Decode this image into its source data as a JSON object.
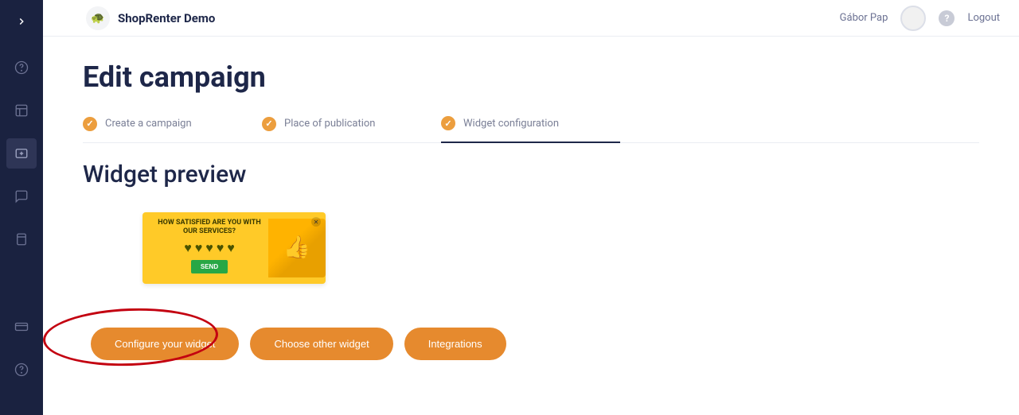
{
  "brand": {
    "name": "ShopRenter Demo"
  },
  "user": {
    "name": "Gábor Pap",
    "logout_label": "Logout"
  },
  "page": {
    "title": "Edit campaign",
    "section_title": "Widget preview"
  },
  "steps": [
    {
      "label": "Create a campaign",
      "done": true,
      "active": false
    },
    {
      "label": "Place of publication",
      "done": true,
      "active": false
    },
    {
      "label": "Widget configuration",
      "done": true,
      "active": true
    }
  ],
  "preview": {
    "question": "HOW SATISFIED ARE YOU WITH OUR SERVICES?",
    "send_label": "SEND"
  },
  "actions": {
    "configure": "Configure your widget",
    "choose_other": "Choose other widget",
    "integrations": "Integrations"
  },
  "sidebar_icons": [
    "help-icon",
    "layout-icon",
    "add-widget-icon",
    "message-icon",
    "panel-icon",
    "card-icon",
    "question-icon"
  ]
}
